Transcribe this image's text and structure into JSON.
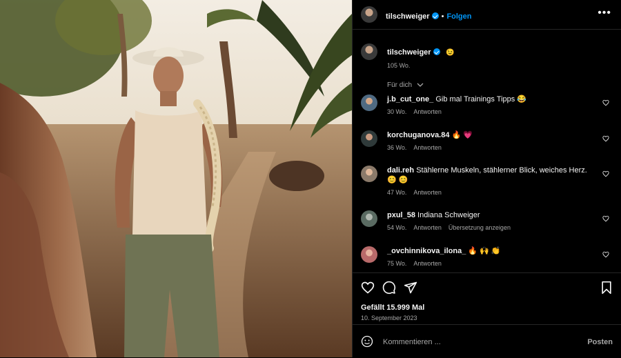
{
  "post": {
    "username": "tilschweiger",
    "follow_label": "Folgen",
    "separator": "•",
    "more_label": "•••"
  },
  "caption": {
    "username": "tilschweiger",
    "emoji": "😉",
    "time": "105 Wo."
  },
  "filter": {
    "label": "Für dich"
  },
  "comments": [
    {
      "username": "j.b_cut_one_",
      "text": "Gib mal Trainings Tipps 😂",
      "time": "30 Wo.",
      "reply": "Antworten",
      "translate": ""
    },
    {
      "username": "korchuganova.84",
      "text": "🔥 💗",
      "time": "36 Wo.",
      "reply": "Antworten",
      "translate": ""
    },
    {
      "username": "dali.reh",
      "text": "Stählerne Muskeln, stählerner Blick, weiches Herz. 😊 😊",
      "time": "47 Wo.",
      "reply": "Antworten",
      "translate": ""
    },
    {
      "username": "pxul_58",
      "text": "Indiana Schweiger",
      "time": "54 Wo.",
      "reply": "Antworten",
      "translate": "Übersetzung anzeigen"
    },
    {
      "username": "_ovchinnikova_ilona_",
      "text": "🔥 🙌 👏",
      "time": "75 Wo.",
      "reply": "Antworten",
      "translate": ""
    }
  ],
  "stats": {
    "likes": "Gefällt 15.999 Mal",
    "date": "10. September 2023"
  },
  "composer": {
    "placeholder": "Kommentieren ...",
    "post_label": "Posten"
  },
  "icons": {
    "like": "heart-icon",
    "comment": "comment-icon",
    "share": "share-icon",
    "save": "bookmark-icon",
    "emoji": "emoji-icon",
    "more": "more-icon"
  },
  "colors": {
    "accent": "#0095f6",
    "background": "#000000",
    "muted": "#a8a8a8"
  }
}
